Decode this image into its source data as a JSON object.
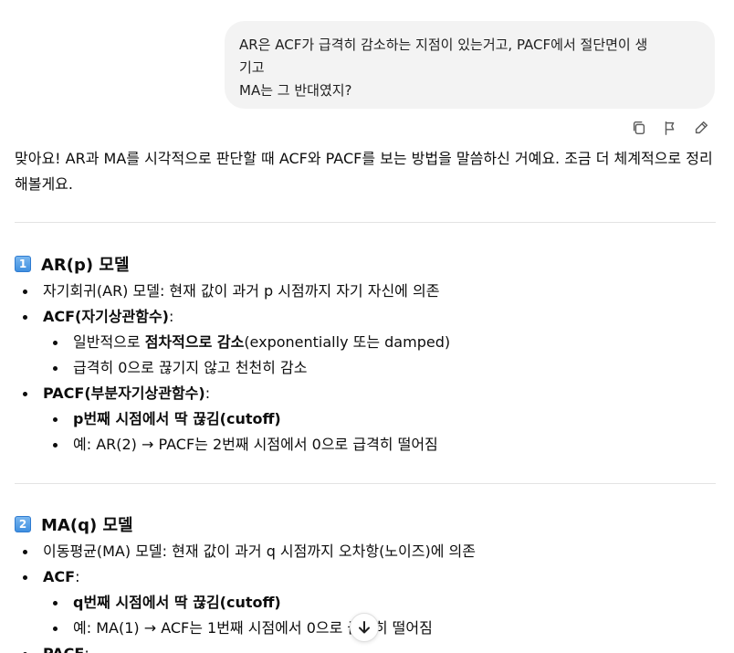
{
  "user_message": {
    "line1": "AR은 ACF가 급격히 감소하는 지점이 있는거고, PACF에서 절단면이 생",
    "line2": "기고",
    "line3": "MA는 그 반대였지?"
  },
  "message_actions": [
    "copy-icon",
    "flag-icon",
    "edit-icon"
  ],
  "assistant": {
    "intro": "맞아요! AR과 MA를 시각적으로 판단할 때 ACF와 PACF를 보는 방법을 말씀하신 거예요. 조금 더 체계적으로 정리해볼게요.",
    "ar": {
      "badge": "1",
      "title": "AR(p) 모델",
      "def": "자기회귀(AR) 모델: 현재 값이 과거 p 시점까지 자기 자신에 의존",
      "acf_label": "ACF(자기상관함수)",
      "acf_suffix": ":",
      "acf_item1_pre": "일반적으로 ",
      "acf_item1_bold": "점차적으로 감소",
      "acf_item1_post": "(exponentially 또는 damped)",
      "acf_item2": "급격히 0으로 끊기지 않고 천천히 감소",
      "pacf_label": "PACF(부분자기상관함수)",
      "pacf_suffix": ":",
      "pacf_item1": "p번째 시점에서 딱 끊김(cutoff)",
      "pacf_item2": "예: AR(2) → PACF는 2번째 시점에서 0으로 급격히 떨어짐"
    },
    "ma": {
      "badge": "2",
      "title": "MA(q) 모델",
      "def": "이동평균(MA) 모델: 현재 값이 과거 q 시점까지 오차항(노이즈)에 의존",
      "acf_label": "ACF",
      "acf_suffix": ":",
      "acf_item1": "q번째 시점에서 딱 끊김(cutoff)",
      "acf_item2": "예: MA(1) → ACF는 1번째 시점에서 0으로 급격히 떨어짐",
      "pacf_label": "PACF",
      "pacf_suffix": ":"
    }
  },
  "scroll_button": "arrow-down-icon"
}
